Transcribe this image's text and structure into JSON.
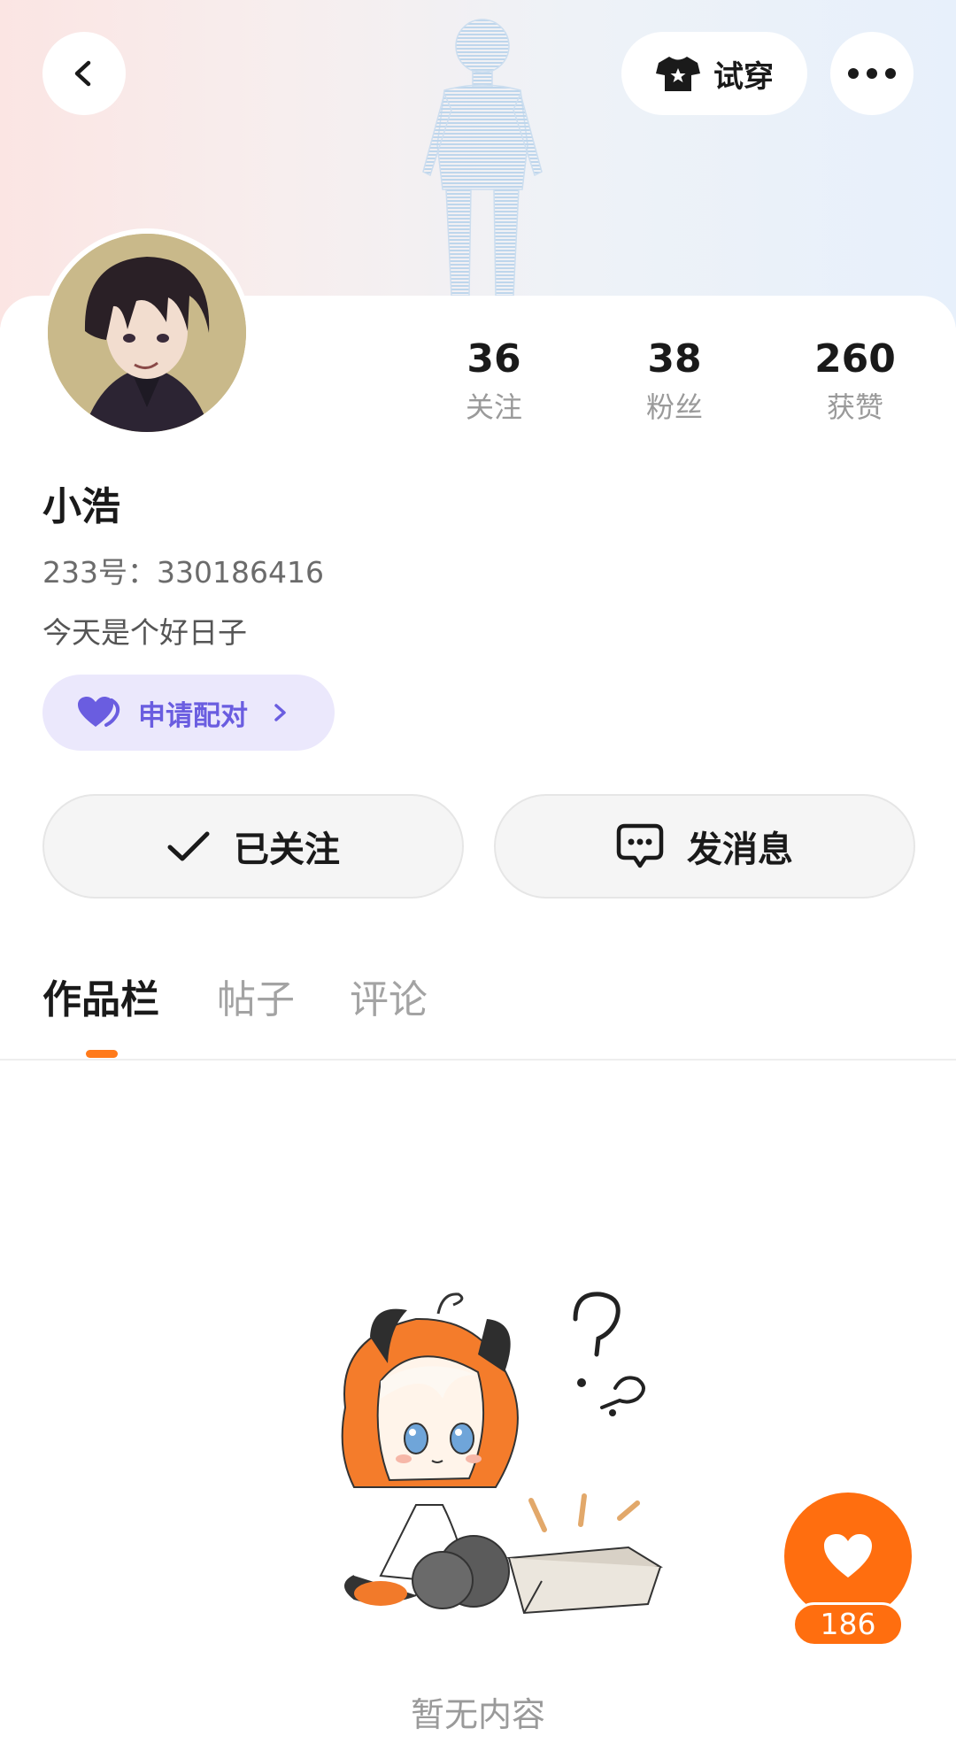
{
  "header": {
    "tryon_label": "试穿",
    "icons": {
      "back": "chevron-left-icon",
      "tryon": "tshirt-icon",
      "more": "more-dots-icon"
    }
  },
  "profile": {
    "name": "小浩",
    "uid": "233号：330186416",
    "bio": "今天是个好日子",
    "pair_label": "申请配对"
  },
  "stats": [
    {
      "value": "36",
      "label": "关注"
    },
    {
      "value": "38",
      "label": "粉丝"
    },
    {
      "value": "260",
      "label": "获赞"
    }
  ],
  "actions": {
    "follow_label": "已关注",
    "message_label": "发消息"
  },
  "tabs": [
    {
      "label": "作品栏",
      "active": true
    },
    {
      "label": "帖子",
      "active": false
    },
    {
      "label": "评论",
      "active": false
    }
  ],
  "empty": {
    "text": "暂无内容"
  },
  "like": {
    "count": "186"
  },
  "colors": {
    "accent": "#ff6e0f",
    "pair_bg": "#ebe8fc",
    "pair_text": "#6a5de0"
  }
}
